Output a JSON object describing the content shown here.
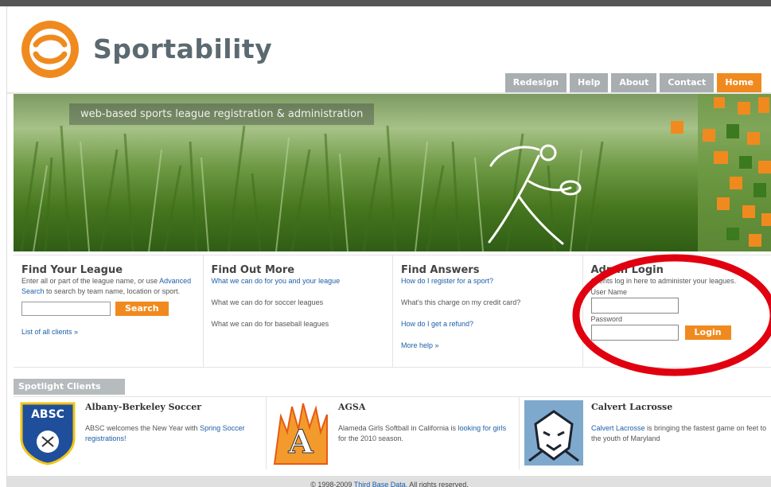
{
  "brand": {
    "name": "Sportability",
    "tagline": "web-based sports league registration & administration"
  },
  "nav": [
    {
      "label": "Redesign",
      "active": false
    },
    {
      "label": "Help",
      "active": false
    },
    {
      "label": "About",
      "active": false
    },
    {
      "label": "Contact",
      "active": false
    },
    {
      "label": "Home",
      "active": true
    }
  ],
  "find_league": {
    "title": "Find Your League",
    "text_before": "Enter all or part of the league name, or use",
    "advanced_link": "Advanced Search",
    "text_after": "to search by team name, location or sport.",
    "search_value": "",
    "search_button": "Search",
    "clients_link": "List of all clients »"
  },
  "find_more": {
    "title": "Find Out More",
    "links": [
      "What we can do for you and your league",
      "What we can do for soccer leagues",
      "What we can do for baseball leagues"
    ]
  },
  "find_answers": {
    "title": "Find Answers",
    "links": [
      "How do I register for a sport?",
      "What's this charge on my credit card?",
      "How do I get a refund?",
      "More help »"
    ]
  },
  "login": {
    "title": "Admin Login",
    "intro": "Clients log in here to administer your leagues.",
    "username_label": "User Name",
    "username_value": "",
    "password_label": "Password",
    "password_value": "",
    "button": "Login"
  },
  "spotlight": {
    "heading": "Spotlight Clients",
    "clients": [
      {
        "name": "Albany-Berkeley Soccer",
        "logo_text": "ABSC",
        "text_before": "ABSC welcomes the New Year with",
        "link": "Spring Soccer registrations!",
        "text_after": ""
      },
      {
        "name": "AGSA",
        "logo_text": "A",
        "text_before": "Alameda Girls Softball in California is",
        "link": "looking for girls",
        "text_after": "for the 2010 season."
      },
      {
        "name": "Calvert Lacrosse",
        "logo_text": "",
        "text_before": "",
        "link": "Calvert Lacrosse",
        "text_after": "is bringing the fastest game on feet to the youth of Maryland"
      }
    ]
  },
  "footer": {
    "text_before": "© 1998-2009",
    "link": "Third Base Data.",
    "text_after": "All rights reserved."
  },
  "colors": {
    "accent": "#f08a1f",
    "nav_gray": "#a9aeb1",
    "link": "#1e5fa8",
    "annotation": "#e0000f"
  }
}
